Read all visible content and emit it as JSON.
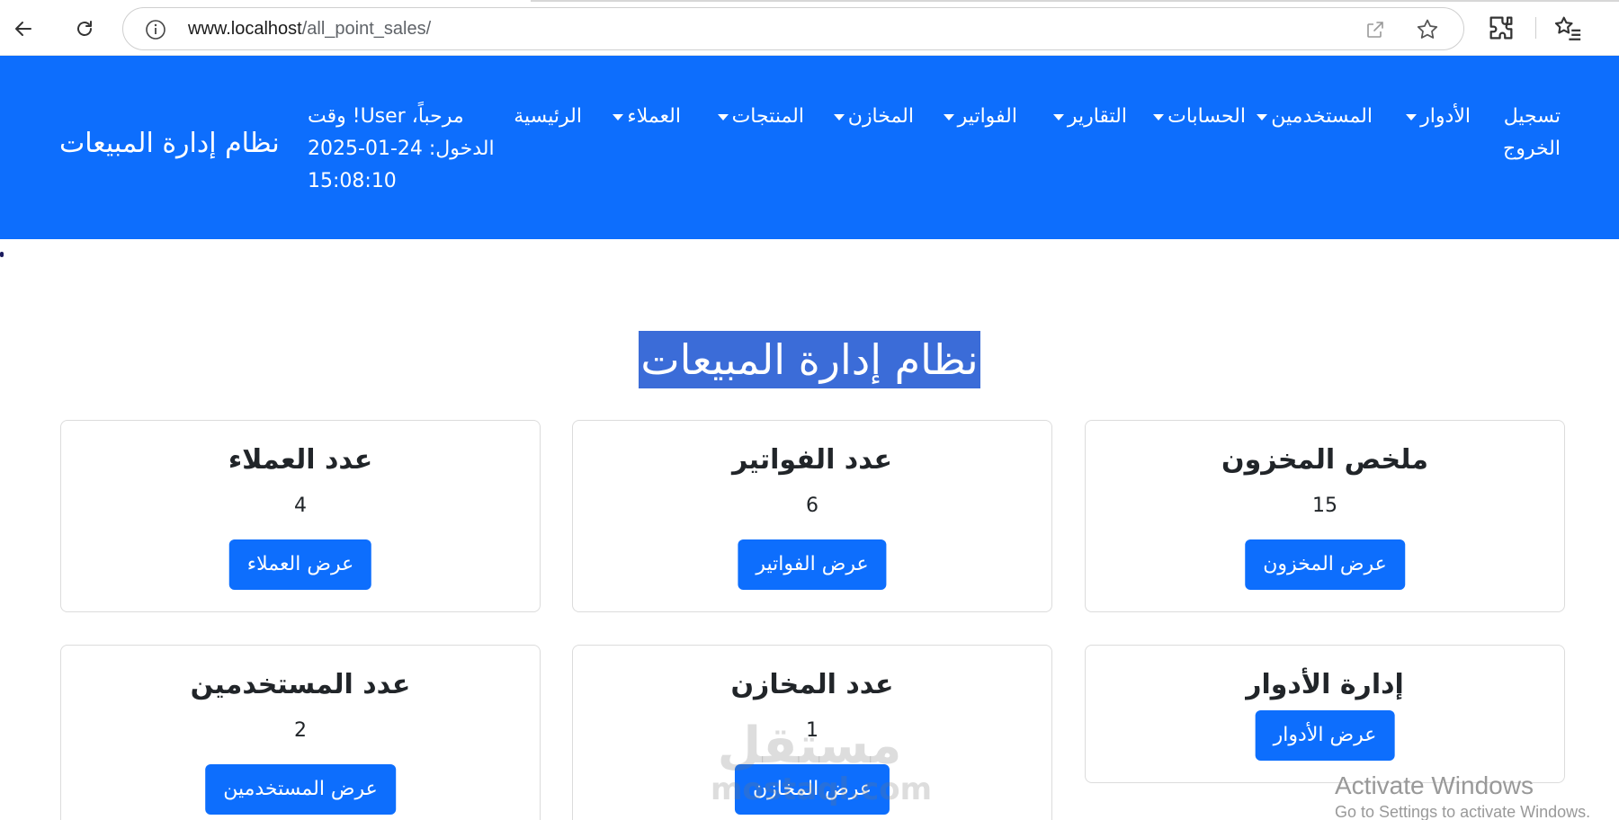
{
  "browser": {
    "url_host": "www.localhost",
    "url_path": "/all_point_sales/"
  },
  "navbar": {
    "brand": "نظام إدارة المبيعات",
    "welcome_line1": "مرحباً، User! وقت",
    "welcome_line2": "الدخول: 24-01-2025",
    "welcome_line3": "15:08:10",
    "links": [
      {
        "label": "الرئيسية",
        "dropdown": false
      },
      {
        "label": "العملاء",
        "dropdown": true
      },
      {
        "label": "المنتجات",
        "dropdown": true
      },
      {
        "label": "المخازن",
        "dropdown": true
      },
      {
        "label": "الفواتير",
        "dropdown": true
      },
      {
        "label": "التقارير",
        "dropdown": true
      },
      {
        "label": "الحسابات",
        "dropdown": true
      },
      {
        "label": "المستخدمين",
        "dropdown": true
      },
      {
        "label": "الأدوار",
        "dropdown": true
      }
    ],
    "logout_line1": "تسجيل",
    "logout_line2": "الخروج"
  },
  "page": {
    "title": "نظام إدارة المبيعات"
  },
  "cards": {
    "inventory": {
      "title": "ملخص المخزون",
      "value": "15",
      "button": "عرض المخزون"
    },
    "invoices": {
      "title": "عدد الفواتير",
      "value": "6",
      "button": "عرض الفواتير"
    },
    "customers": {
      "title": "عدد العملاء",
      "value": "4",
      "button": "عرض العملاء"
    },
    "roles": {
      "title": "إدارة الأدوار",
      "button": "عرض الأدوار"
    },
    "warehouses": {
      "title": "عدد المخازن",
      "value": "1",
      "button": "عرض المخازن"
    },
    "users": {
      "title": "عدد المستخدمين",
      "value": "2",
      "button": "عرض المستخدمين"
    }
  },
  "overlays": {
    "watermark_ar": "مستقل",
    "watermark_en": "mostaql.com",
    "activate_title": "Activate Windows",
    "activate_sub": "Go to Settings to activate Windows."
  },
  "colors": {
    "primary": "#0d6efd",
    "title_highlight": "#3b6cd8"
  }
}
